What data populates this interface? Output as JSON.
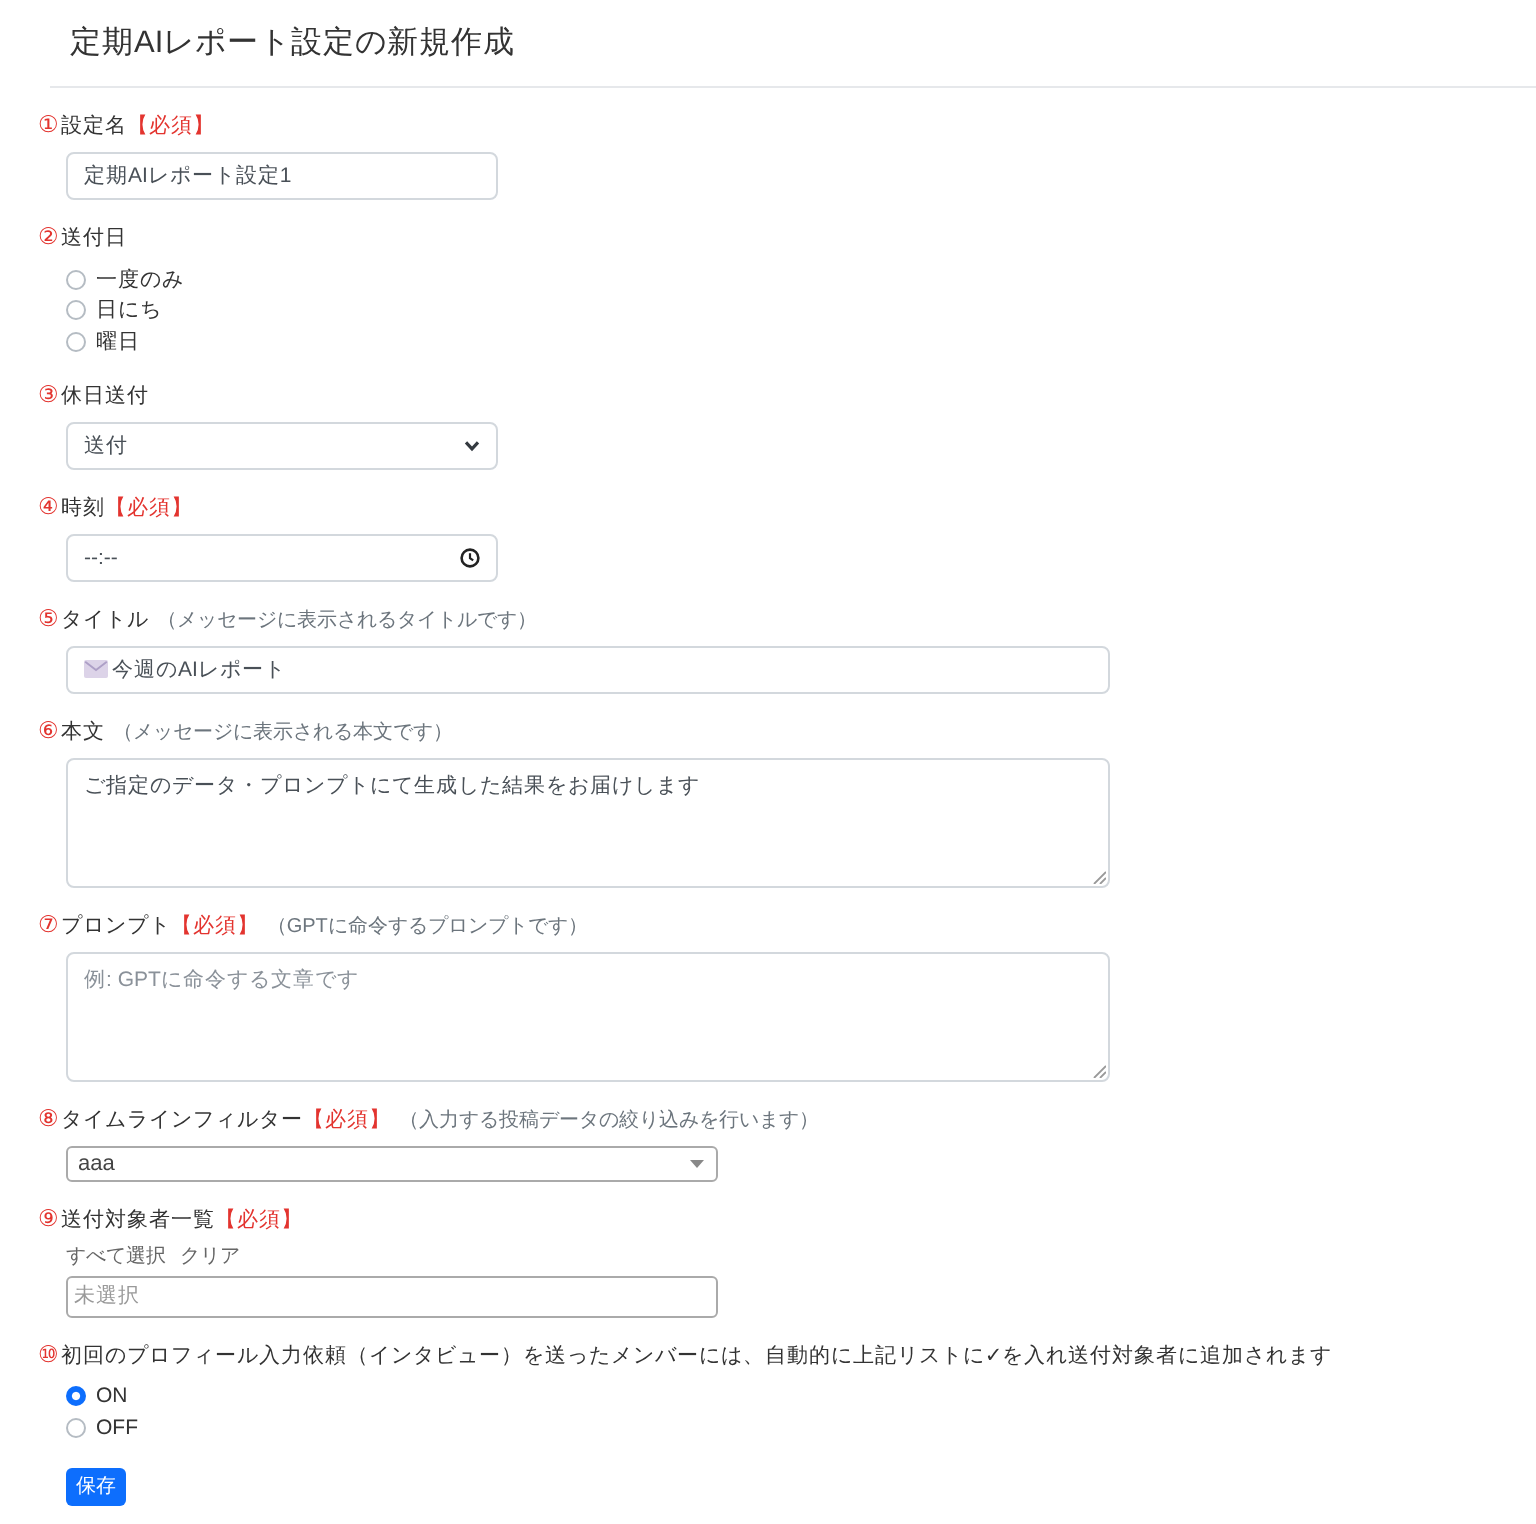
{
  "page": {
    "title": "定期AIレポート設定の新規作成"
  },
  "fields": [
    {
      "kind": "text",
      "number": "①",
      "label": "設定名",
      "required": "【必須】",
      "value": "定期AIレポート設定1"
    },
    {
      "kind": "radio",
      "number": "②",
      "label": "送付日",
      "options": [
        {
          "label": "一度のみ",
          "selected": false
        },
        {
          "label": "日にち",
          "selected": false
        },
        {
          "label": "曜日",
          "selected": false
        }
      ]
    },
    {
      "kind": "select",
      "number": "③",
      "label": "休日送付",
      "value": "送付"
    },
    {
      "kind": "time",
      "number": "④",
      "label": "時刻",
      "required": "【必須】",
      "value": "--:--"
    },
    {
      "kind": "text",
      "number": "⑤",
      "label": "タイトル",
      "hint": "（メッセージに表示されるタイトルです）",
      "icon": true,
      "value": "今週のAIレポート"
    },
    {
      "kind": "textarea",
      "number": "⑥",
      "label": "本文",
      "hint": "（メッセージに表示される本文です）",
      "value": "ご指定のデータ・プロンプトにて生成した結果をお届けします"
    },
    {
      "kind": "textarea",
      "number": "⑦",
      "label": "プロンプト",
      "required": "【必須】",
      "hint": "（GPTに命令するプロンプトです）",
      "placeholder": "例: GPTに命令する文章です"
    },
    {
      "kind": "combo",
      "number": "⑧",
      "label": "タイムラインフィルター",
      "required": "【必須】",
      "hint": "（入力する投稿データの絞り込みを行います）",
      "value": "aaa"
    },
    {
      "kind": "multi",
      "number": "⑨",
      "label": "送付対象者一覧",
      "required": "【必須】",
      "links": [
        "すべて選択",
        "クリア"
      ],
      "placeholder": "未選択"
    },
    {
      "kind": "radio",
      "number": "⑩",
      "label": "初回のプロフィール入力依頼（インタビュー）を送ったメンバーには、自動的に上記リストに✓を入れ送付対象者に追加されます",
      "options": [
        {
          "label": "ON",
          "selected": true
        },
        {
          "label": "OFF",
          "selected": false
        }
      ]
    }
  ],
  "save_button": "保存"
}
